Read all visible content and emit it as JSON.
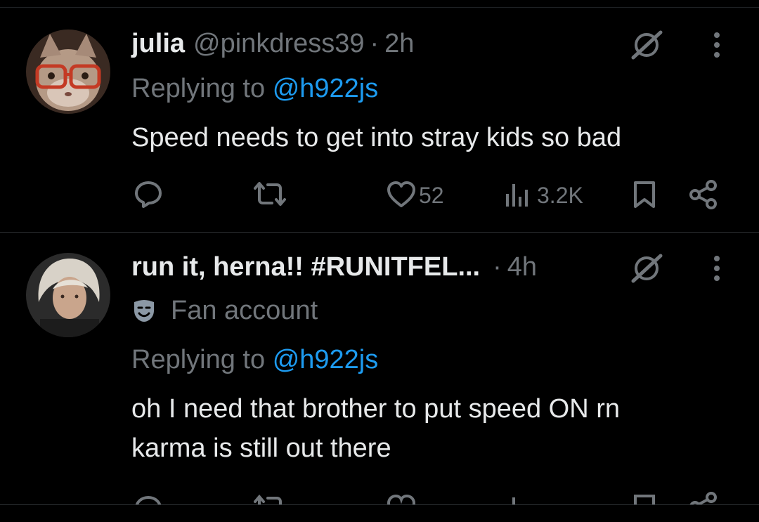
{
  "colors": {
    "background": "#000000",
    "text": "#e7e9ea",
    "muted": "#71767b",
    "accent": "#1d9bf0"
  },
  "tweets": [
    {
      "display_name": "julia",
      "handle": "@pinkdress39",
      "separator": "·",
      "time": "2h",
      "replying_prefix": "Replying to",
      "replying_to": "@h922js",
      "text": "Speed needs to get into stray kids so bad",
      "likes": "52",
      "views": "3.2K",
      "icons": [
        "reply-icon",
        "retweet-icon",
        "like-icon",
        "views-icon",
        "bookmark-icon",
        "share-icon",
        "grok-icon",
        "more-icon"
      ]
    },
    {
      "display_name": "run it, herna!! #RUNITFEL...",
      "handle": "",
      "separator": "·",
      "time": "4h",
      "badge_label": "Fan account",
      "replying_prefix": "Replying to",
      "replying_to": "@h922js",
      "text": "oh I need that brother to put speed ON rn\nkarma is still out there",
      "icons": [
        "fan-mask-icon",
        "reply-icon",
        "retweet-icon",
        "like-icon",
        "views-icon",
        "bookmark-icon",
        "share-icon",
        "grok-icon",
        "more-icon"
      ]
    }
  ]
}
